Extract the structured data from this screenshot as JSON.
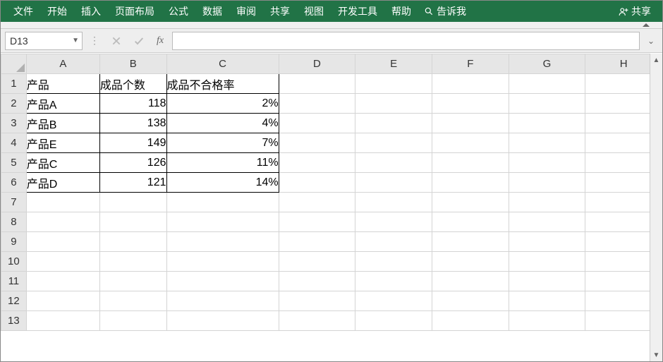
{
  "ribbon": {
    "tabs": [
      "文件",
      "开始",
      "插入",
      "页面布局",
      "公式",
      "数据",
      "审阅",
      "共享",
      "视图",
      "开发工具",
      "帮助"
    ],
    "tell_me": "告诉我",
    "share": "共享"
  },
  "formula_bar": {
    "name_box": "D13",
    "fx_label": "fx",
    "cancel_title": "取消",
    "enter_title": "输入",
    "formula_value": ""
  },
  "grid": {
    "columns": [
      "A",
      "B",
      "C",
      "D",
      "E",
      "F",
      "G",
      "H"
    ],
    "row_count": 13,
    "headers": {
      "A": "产品",
      "B": "成品个数",
      "C": "成品不合格率"
    },
    "rows": [
      {
        "A": "产品A",
        "B": "118",
        "C": "2%"
      },
      {
        "A": "产品B",
        "B": "138",
        "C": "4%"
      },
      {
        "A": "产品E",
        "B": "149",
        "C": "7%"
      },
      {
        "A": "产品C",
        "B": "126",
        "C": "11%"
      },
      {
        "A": "产品D",
        "B": "121",
        "C": "14%"
      }
    ]
  },
  "chart_data": {
    "type": "table",
    "title": "",
    "columns": [
      "产品",
      "成品个数",
      "成品不合格率"
    ],
    "rows": [
      [
        "产品A",
        118,
        "2%"
      ],
      [
        "产品B",
        138,
        "4%"
      ],
      [
        "产品E",
        149,
        "7%"
      ],
      [
        "产品C",
        126,
        "11%"
      ],
      [
        "产品D",
        121,
        "14%"
      ]
    ]
  }
}
